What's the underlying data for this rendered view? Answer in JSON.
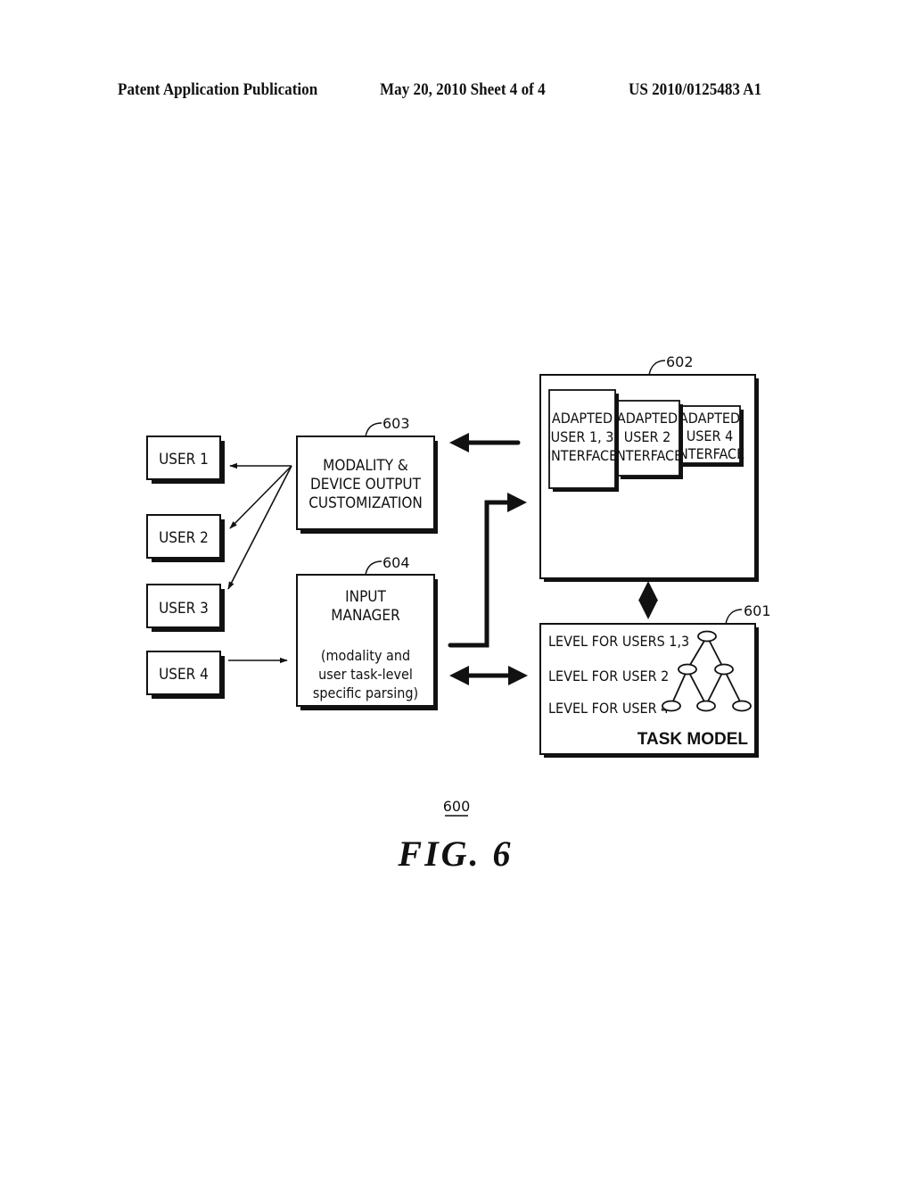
{
  "header": {
    "left": "Patent Application Publication",
    "center": "May 20, 2010  Sheet 4 of 4",
    "right": "US 2010/0125483 A1"
  },
  "diagram": {
    "users": [
      "USER 1",
      "USER 2",
      "USER 3",
      "USER 4"
    ],
    "output_block": {
      "ref": "603",
      "lines": [
        "MODALITY &",
        "DEVICE OUTPUT",
        "CUSTOMIZATION"
      ]
    },
    "input_block": {
      "ref": "604",
      "title_lines": [
        "INPUT",
        "MANAGER"
      ],
      "desc_lines": [
        "(modality and",
        "user task-level",
        "specific parsing)"
      ]
    },
    "interface_block": {
      "ref": "602",
      "interfaces": [
        {
          "lines": [
            "ADAPTED",
            "USER 1, 3",
            "INTERFACE"
          ]
        },
        {
          "lines": [
            "ADAPTED",
            "USER 2",
            "INTERFACE"
          ]
        },
        {
          "lines": [
            "ADAPTED",
            "USER 4",
            "INTERFACE"
          ]
        }
      ]
    },
    "task_model": {
      "ref": "601",
      "levels": [
        "LEVEL FOR USERS 1,3",
        "LEVEL FOR USER 2",
        "LEVEL FOR USER 4"
      ],
      "title": "TASK MODEL"
    },
    "figure_ref": "600",
    "figure_label": "FIG. 6"
  }
}
